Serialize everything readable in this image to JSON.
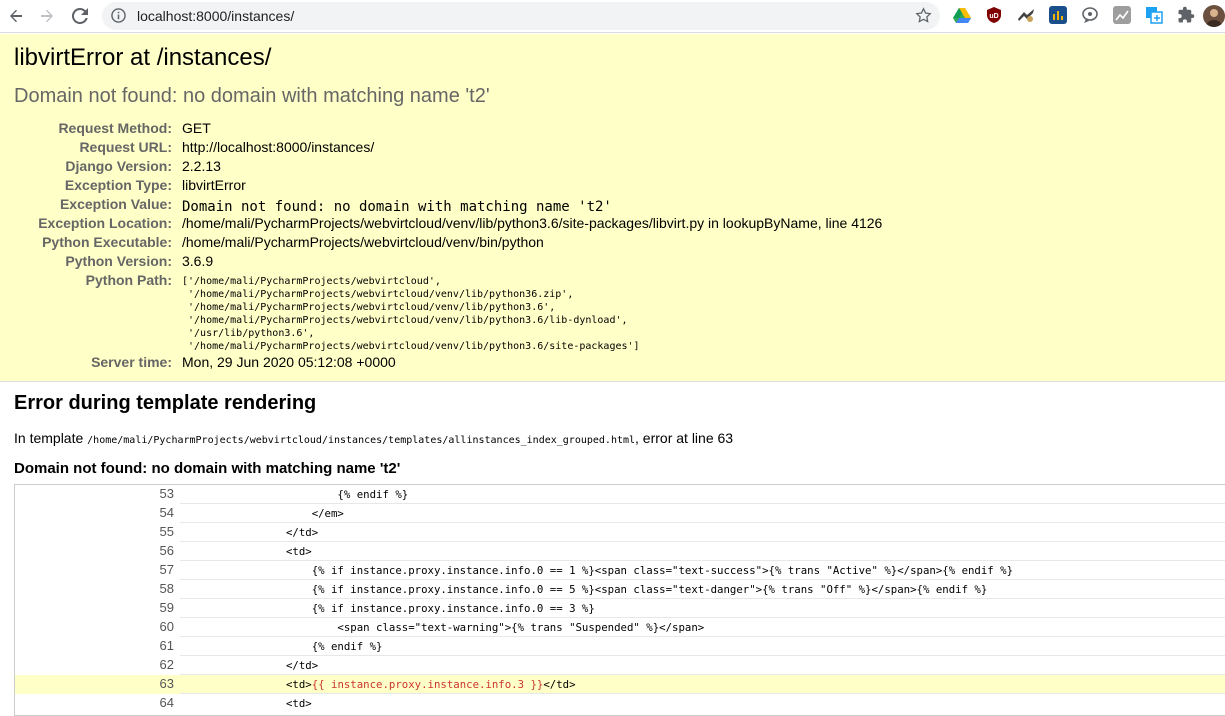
{
  "browser": {
    "url": "localhost:8000/instances/",
    "icons": [
      "back-arrow-icon",
      "forward-arrow-icon",
      "reload-icon",
      "site-info-icon",
      "bookmark-star-icon",
      "google-drive-icon",
      "ublock-icon",
      "extension-icon",
      "analytics-icon",
      "chat-extension-icon",
      "chart-extension-icon",
      "translate-icon",
      "puzzle-extensions-icon",
      "avatar"
    ]
  },
  "error": {
    "title": "libvirtError at /instances/",
    "message": "Domain not found: no domain with matching name 't2'"
  },
  "meta": [
    {
      "label": "Request Method:",
      "value": "GET"
    },
    {
      "label": "Request URL:",
      "value": "http://localhost:8000/instances/"
    },
    {
      "label": "Django Version:",
      "value": "2.2.13"
    },
    {
      "label": "Exception Type:",
      "value": "libvirtError"
    },
    {
      "label": "Exception Value:",
      "value": "Domain not found: no domain with matching name 't2'"
    },
    {
      "label": "Exception Location:",
      "value": "/home/mali/PycharmProjects/webvirtcloud/venv/lib/python3.6/site-packages/libvirt.py in lookupByName, line 4126"
    },
    {
      "label": "Python Executable:",
      "value": "/home/mali/PycharmProjects/webvirtcloud/venv/bin/python"
    },
    {
      "label": "Python Version:",
      "value": "3.6.9"
    },
    {
      "label": "Python Path:",
      "value": "['/home/mali/PycharmProjects/webvirtcloud',\n '/home/mali/PycharmProjects/webvirtcloud/venv/lib/python36.zip',\n '/home/mali/PycharmProjects/webvirtcloud/venv/lib/python3.6',\n '/home/mali/PycharmProjects/webvirtcloud/venv/lib/python3.6/lib-dynload',\n '/usr/lib/python3.6',\n '/home/mali/PycharmProjects/webvirtcloud/venv/lib/python3.6/site-packages']"
    },
    {
      "label": "Server time:",
      "value": "Mon, 29 Jun 2020 05:12:08 +0000"
    }
  ],
  "template": {
    "heading": "Error during template rendering",
    "in_template_prefix": "In template",
    "template_path": "/home/mali/PycharmProjects/webvirtcloud/instances/templates/allinstances_index_grouped.html",
    "error_at": ", error at line 63",
    "error_heading": "Domain not found: no domain with matching name 't2'",
    "lines": [
      {
        "num": "53",
        "code": "                        {% endif %}"
      },
      {
        "num": "54",
        "code": "                    </em>"
      },
      {
        "num": "55",
        "code": "                </td>"
      },
      {
        "num": "56",
        "code": "                <td>"
      },
      {
        "num": "57",
        "code": "                    {% if instance.proxy.instance.info.0 == 1 %}<span class=\"text-success\">{% trans \"Active\" %}</span>{% endif %}"
      },
      {
        "num": "58",
        "code": "                    {% if instance.proxy.instance.info.0 == 5 %}<span class=\"text-danger\">{% trans \"Off\" %}</span>{% endif %}"
      },
      {
        "num": "59",
        "code": "                    {% if instance.proxy.instance.info.0 == 3 %}"
      },
      {
        "num": "60",
        "code": "                        <span class=\"text-warning\">{% trans \"Suspended\" %}</span>"
      },
      {
        "num": "61",
        "code": "                    {% endif %}"
      },
      {
        "num": "62",
        "code": "                </td>"
      },
      {
        "num": "63",
        "pre": "                <td>",
        "err": "{{ instance.proxy.instance.info.3 }}",
        "post": "</td>",
        "highlight": true
      },
      {
        "num": "64",
        "code": "                <td>"
      }
    ]
  }
}
